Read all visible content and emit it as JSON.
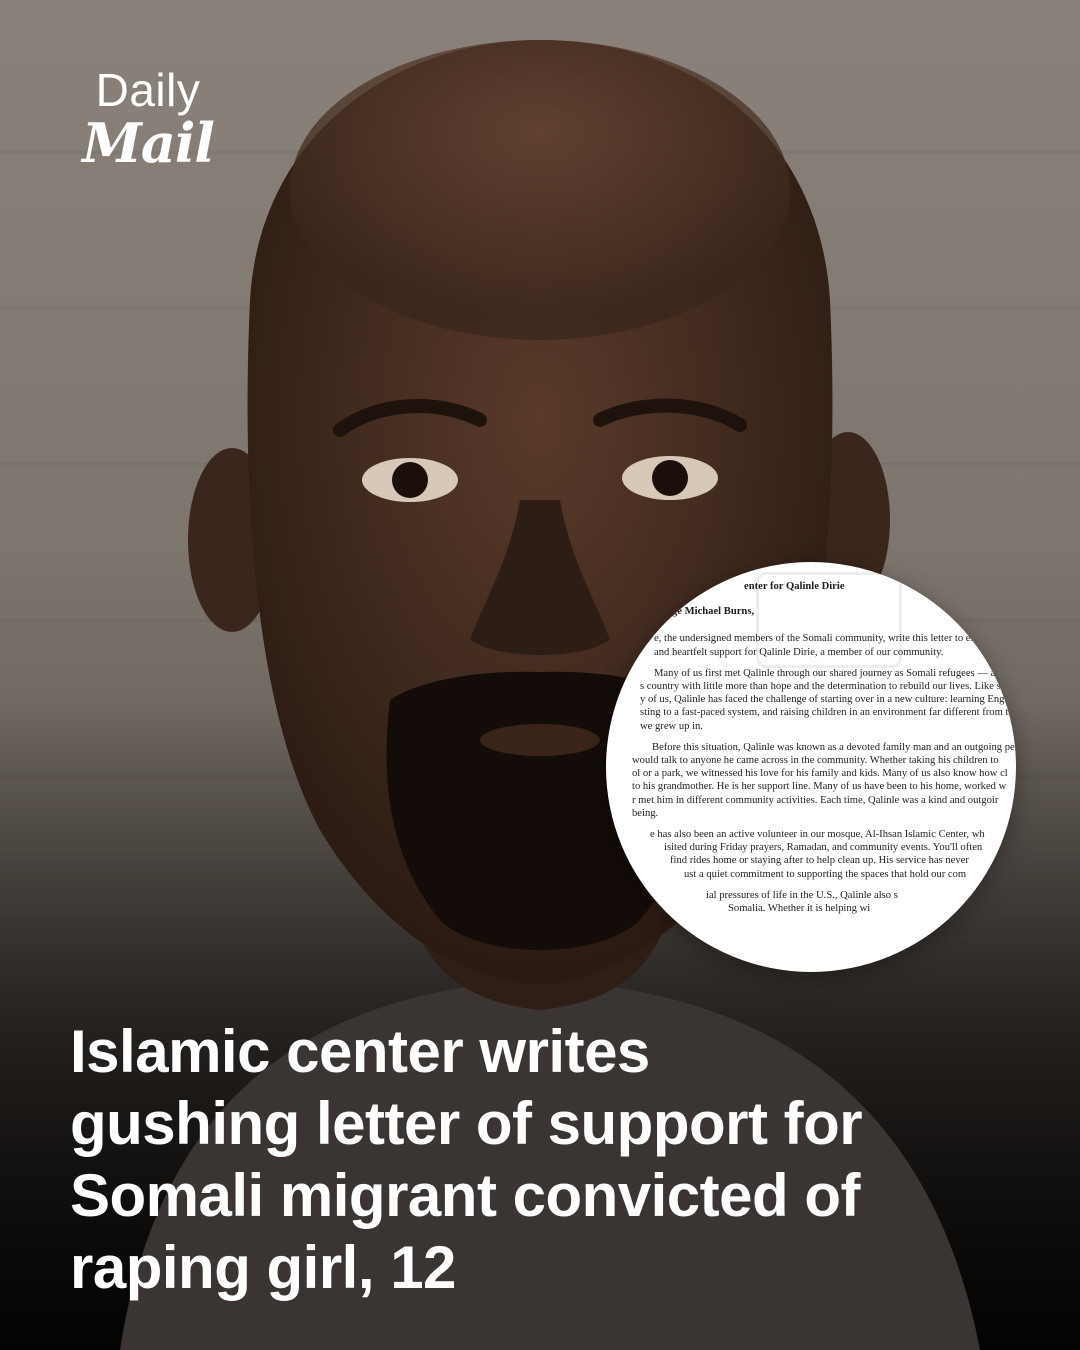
{
  "brand": {
    "line1": "Daily",
    "line2": "Mail"
  },
  "letter": {
    "lines_block1": [
      "enter for Qalinle Dirie"
    ],
    "lines_block2": [
      "ge Michael Burns,"
    ],
    "lines_block3": [
      "e, the undersigned members of the Somali community, write this letter to expr",
      "and heartfelt support for Qalinle Dirie, a member of our community."
    ],
    "lines_block4": [
      "Many of us first met Qalinle through our shared journey as Somali refugees — arriv",
      "s country with little more than hope and the determination to rebuild our lives. Like so",
      "y of us, Qalinle has faced the challenge of starting over in a new culture: learning English",
      "sting to a fast-paced system, and raising children in an environment far different from the",
      "we grew up in."
    ],
    "lines_block5": [
      "Before this situation, Qalinle was known as a devoted family man and an outgoing pers",
      "would talk to anyone he came across in the community. Whether taking his children to",
      "ol or a park, we witnessed his love for his family and kids. Many of us also know how cl",
      "to his grandmother. He is her support line. Many of us have been to his home, worked w",
      "r met him in different community activities. Each time, Qalinle was a kind and outgoir",
      "being."
    ],
    "lines_block6": [
      "e has also been an active volunteer in our mosque, Al-Ihsan Islamic Center, wh",
      "isited during Friday prayers, Ramadan, and community events. You'll often",
      "find rides home or staying after to help clean up. His service has never",
      "ust a quiet commitment to supporting the spaces that hold our com"
    ],
    "lines_block7": [
      "ial pressures of life in the U.S., Qalinle also s",
      "Somalia. Whether it is helping wi"
    ]
  },
  "headline": {
    "lines": [
      "Islamic center writes",
      "gushing letter of support for",
      "Somali migrant convicted of",
      "raping girl, 12"
    ]
  },
  "colors": {
    "background_top": "#8a827a",
    "background_bottom": "#2f2925",
    "text": "#ffffff",
    "letter_paper": "#ffffff"
  }
}
